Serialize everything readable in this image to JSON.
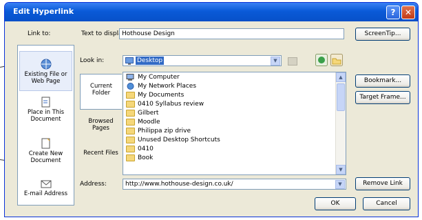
{
  "dialog": {
    "title": "Edit Hyperlink",
    "help_glyph": "?",
    "close_glyph": "✕"
  },
  "link_to": {
    "label": "Link to:",
    "items": [
      {
        "label": "Existing File or Web Page",
        "icon": "globe-page-icon"
      },
      {
        "label": "Place in This Document",
        "icon": "document-place-icon"
      },
      {
        "label": "Create New Document",
        "icon": "new-document-icon"
      },
      {
        "label": "E-mail Address",
        "icon": "email-icon"
      }
    ]
  },
  "text_to_display": {
    "label": "Text to display:",
    "value": "Hothouse Design"
  },
  "look_in": {
    "label": "Look in:",
    "value": "Desktop"
  },
  "side_tabs": [
    {
      "label": "Current Folder"
    },
    {
      "label": "Browsed Pages"
    },
    {
      "label": "Recent Files"
    }
  ],
  "file_list": [
    {
      "name": "My Computer",
      "icon": "computer-icon"
    },
    {
      "name": "My Network Places",
      "icon": "network-icon"
    },
    {
      "name": "My Documents",
      "icon": "folder-icon"
    },
    {
      "name": "0410 Syllabus review",
      "icon": "folder-icon"
    },
    {
      "name": "Gilbert",
      "icon": "folder-icon"
    },
    {
      "name": "Moodle",
      "icon": "folder-icon"
    },
    {
      "name": "Philippa zip drive",
      "icon": "folder-icon"
    },
    {
      "name": "Unused Desktop Shortcuts",
      "icon": "folder-icon"
    },
    {
      "name": "0410",
      "icon": "folder-icon"
    },
    {
      "name": "Book",
      "icon": "folder-icon"
    }
  ],
  "address": {
    "label": "Address:",
    "value": "http://www.hothouse-design.co.uk/"
  },
  "buttons": {
    "screentip": "ScreenTip...",
    "bookmark": "Bookmark...",
    "target_frame": "Target Frame...",
    "remove_link": "Remove Link",
    "ok": "OK",
    "cancel": "Cancel"
  },
  "colors": {
    "titlebar": "#0a5ad8",
    "dialog_bg": "#ece9d8",
    "selection": "#316ac5"
  }
}
